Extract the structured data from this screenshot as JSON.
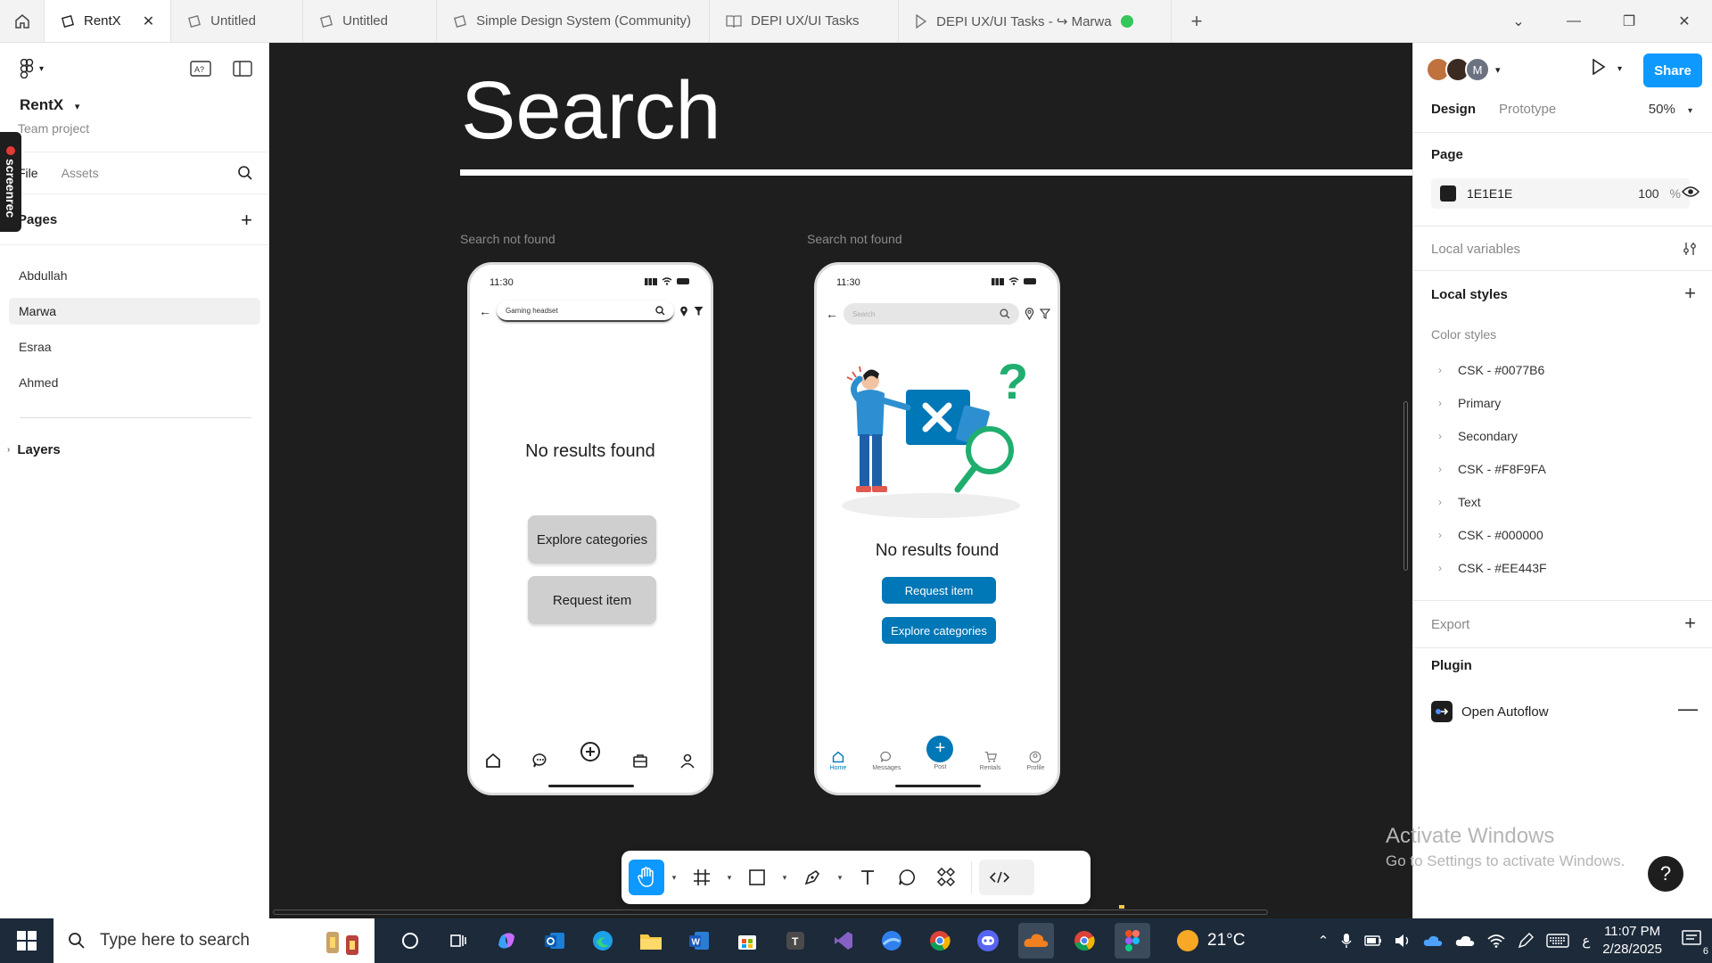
{
  "tabs": [
    {
      "label": "RentX",
      "active": true
    },
    {
      "label": "Untitled"
    },
    {
      "label": "Untitled"
    },
    {
      "label": "Simple Design System (Community)"
    },
    {
      "label": "DEPI UX/UI Tasks"
    },
    {
      "label": "DEPI UX/UI Tasks - ↪ Marwa"
    }
  ],
  "left": {
    "project_name": "RentX",
    "team_label": "Team project",
    "file_tab": "File",
    "assets_tab": "Assets",
    "pages_header": "Pages",
    "pages": [
      "Abdullah",
      "Marwa",
      "Esraa",
      "Ahmed"
    ],
    "layers_header": "Layers",
    "screenrec": "screenrec"
  },
  "canvas": {
    "title": "Search",
    "frame1_label": "Search not found",
    "frame2_label": "Search not found",
    "phone1": {
      "time": "11:30",
      "search_value": "Gaming headset",
      "no_results": "No results found",
      "btn1": "Explore categories",
      "btn2": "Request item"
    },
    "phone2": {
      "time": "11:30",
      "search_placeholder": "Search",
      "no_results": "No results found",
      "btn1": "Request item",
      "btn2": "Explore categories",
      "nav": [
        "Home",
        "Messages",
        "Post",
        "Rentals",
        "Profile"
      ]
    }
  },
  "right": {
    "avatar_initial": "M",
    "share": "Share",
    "design_tab": "Design",
    "prototype_tab": "Prototype",
    "zoom": "50%",
    "page_header": "Page",
    "page_color": "1E1E1E",
    "page_opacity": "100",
    "page_opacity_unit": "%",
    "local_variables": "Local variables",
    "local_styles": "Local styles",
    "color_styles": "Color styles",
    "styles": [
      "CSK - #0077B6",
      "Primary",
      "Secondary",
      "CSK - #F8F9FA",
      "Text",
      "CSK - #000000",
      "CSK - #EE443F"
    ],
    "export": "Export",
    "plugin": "Plugin",
    "autoflow": "Open Autoflow"
  },
  "activate": {
    "line1": "Activate Windows",
    "line2": "Go to Settings to activate Windows."
  },
  "taskbar": {
    "search_placeholder": "Type here to search",
    "temperature": "21°C",
    "time": "11:07 PM",
    "date": "2/28/2025",
    "notification_count": "6",
    "lang": "ع"
  },
  "colors": {
    "accent": "#0d99ff",
    "brand_blue": "#0077b6",
    "canvas_bg": "#1e1e1e"
  }
}
